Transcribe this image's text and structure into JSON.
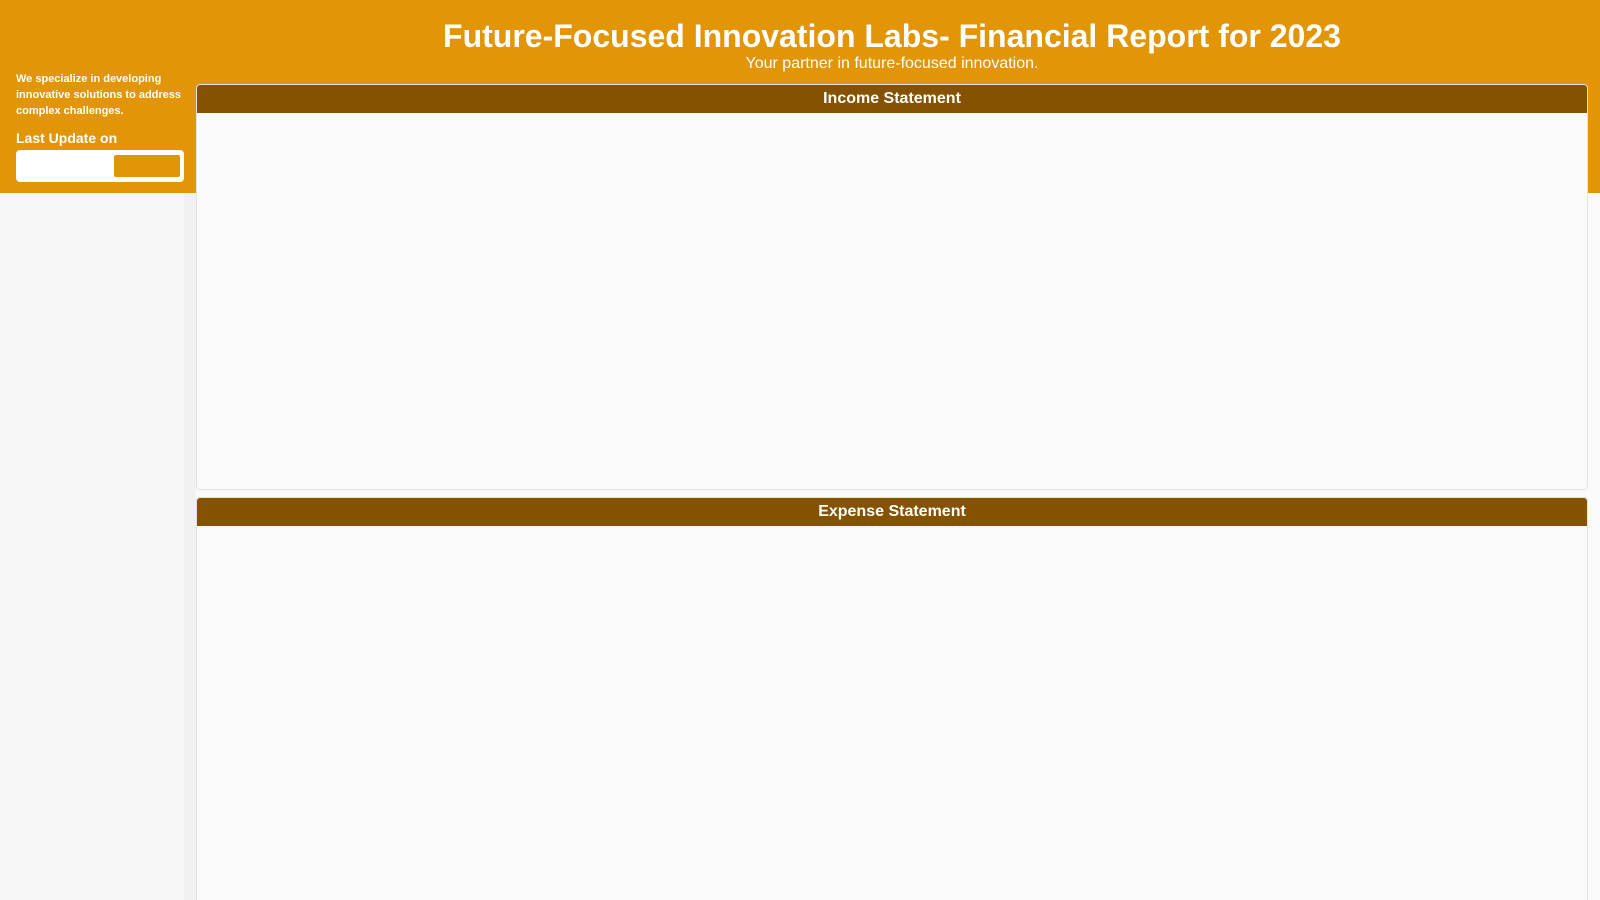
{
  "header": {
    "title": "Future-Focused Innovation Labs- Financial Report for 2023",
    "subtitle": "Your partner in future-focused innovation."
  },
  "sidebar": {
    "description": "We specialize in developing innovative solutions to address complex challenges.",
    "last_update_label": "Last Update on",
    "last_update_value": ""
  },
  "panels": {
    "income_title": "Income Statement",
    "expense_title": "Expense Statement"
  },
  "colors": {
    "brand": "#e19507",
    "panel_header": "#855300",
    "background": "#fafafa"
  }
}
